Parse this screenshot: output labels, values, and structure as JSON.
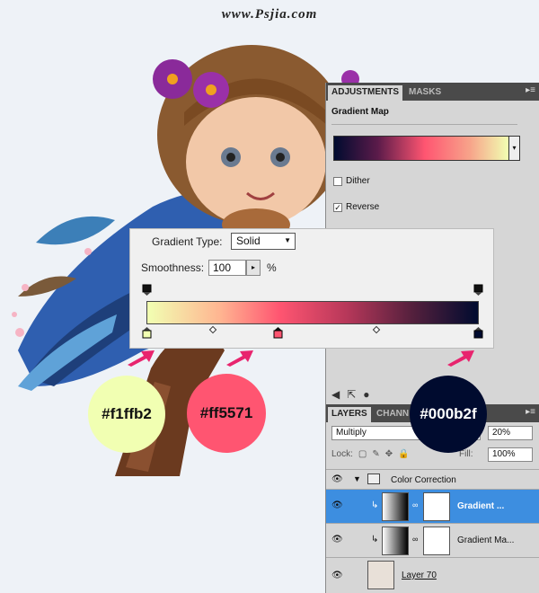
{
  "watermark": "www.Psjia.com",
  "adjustments_panel": {
    "tabs": [
      "ADJUSTMENTS",
      "MASKS"
    ],
    "title": "Gradient Map",
    "dither_label": "Dither",
    "dither_checked": false,
    "reverse_label": "Reverse",
    "reverse_checked": true
  },
  "gradient_editor": {
    "gradient_type_label": "Gradient Type:",
    "gradient_type_value": "Solid",
    "smoothness_label": "Smoothness:",
    "smoothness_value": "100",
    "smoothness_unit": "%",
    "color_stops": [
      "#f1ffb2",
      "#ff5571",
      "#000b2f"
    ]
  },
  "callouts": [
    {
      "label": "#f1ffb2",
      "bg": "#f1ffb2",
      "text_color": "#111111"
    },
    {
      "label": "#ff5571",
      "bg": "#ff5571",
      "text_color": "#111111"
    },
    {
      "label": "#000b2f",
      "bg": "#000b2f",
      "text_color": "#ffffff"
    }
  ],
  "layers_panel": {
    "tabs": [
      "LAYERS",
      "CHANN"
    ],
    "blend_mode": "Multiply",
    "opacity": "20%",
    "lock_label": "Lock:",
    "fill_label": "Fill:",
    "fill_value": "100%",
    "layers": [
      {
        "name": "Color Correction",
        "type": "group"
      },
      {
        "name": "Gradient ...",
        "type": "adjustment",
        "selected": true
      },
      {
        "name": "Gradient Ma...",
        "type": "adjustment",
        "selected": false
      },
      {
        "name": "Layer 70",
        "type": "pixel"
      }
    ]
  },
  "colors": {
    "selected_layer": "#3d8ee0",
    "arrow": "#e8246e",
    "panel_bg": "#d6d6d6"
  }
}
